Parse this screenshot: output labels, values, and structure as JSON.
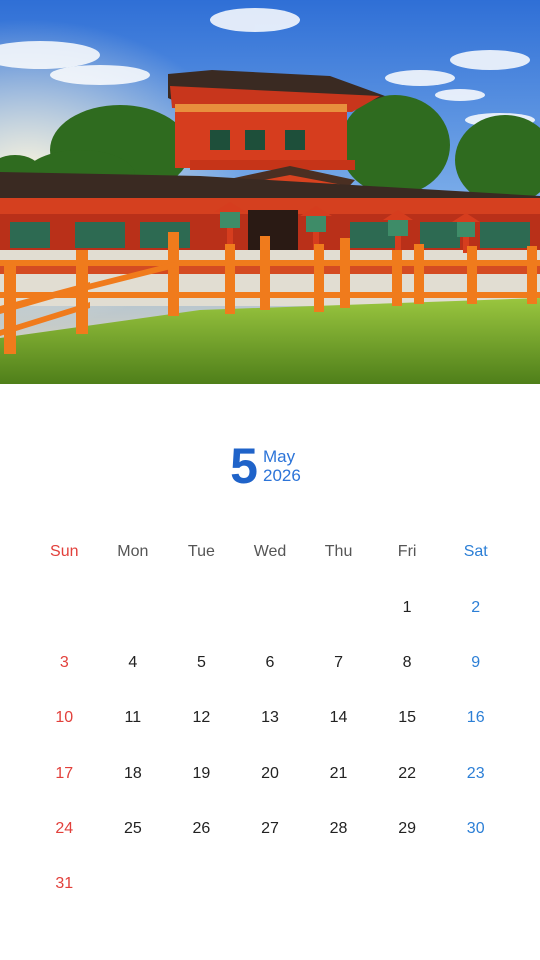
{
  "photo": {
    "subject": "shrine-gate-photo"
  },
  "header": {
    "month_number": "5",
    "month_name": "May",
    "year": "2026"
  },
  "weekdays": [
    "Sun",
    "Mon",
    "Tue",
    "Wed",
    "Thu",
    "Fri",
    "Sat"
  ],
  "weeks": [
    [
      "",
      "",
      "",
      "",
      "",
      "1",
      "2"
    ],
    [
      "3",
      "4",
      "5",
      "6",
      "7",
      "8",
      "9"
    ],
    [
      "10",
      "11",
      "12",
      "13",
      "14",
      "15",
      "16"
    ],
    [
      "17",
      "18",
      "19",
      "20",
      "21",
      "22",
      "23"
    ],
    [
      "24",
      "25",
      "26",
      "27",
      "28",
      "29",
      "30"
    ],
    [
      "31",
      "",
      "",
      "",
      "",
      "",
      ""
    ]
  ],
  "colors": {
    "sunday": "#e2403b",
    "saturday": "#2c7fd6",
    "weekday": "#222222",
    "header_accent": "#1f63c9"
  }
}
